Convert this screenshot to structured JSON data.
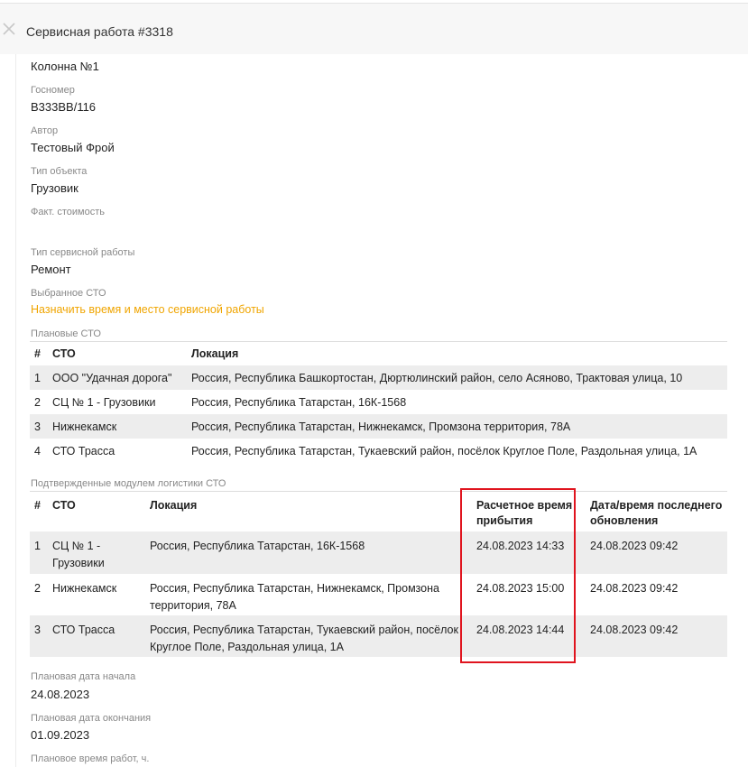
{
  "header": {
    "title": "Сервисная работа #3318"
  },
  "fields": {
    "column_value": "Колонна №1",
    "plate_label": "Госномер",
    "plate_value": "В333ВВ/116",
    "author_label": "Автор",
    "author_value": "Тестовый Фрой",
    "object_type_label": "Тип объекта",
    "object_type_value": "Грузовик",
    "fact_cost_label": "Факт. стоимость",
    "service_type_label": "Тип сервисной работы",
    "service_type_value": "Ремонт",
    "selected_sto_label": "Выбранное СТО",
    "assign_link": "Назначить время и место сервисной работы",
    "planned_sto_label": "Плановые СТО",
    "confirmed_sto_label": "Подтвержденные модулем логистики СТО",
    "plan_start_label": "Плановая дата начала",
    "plan_start_value": "24.08.2023",
    "plan_end_label": "Плановая дата окончания",
    "plan_end_value": "01.09.2023",
    "plan_hours_label": "Плановое время работ, ч."
  },
  "planned_table": {
    "headers": [
      "#",
      "СТО",
      "Локация"
    ],
    "rows": [
      {
        "num": "1",
        "sto": "ООО \"Удачная дорога\"",
        "location": "Россия, Республика Башкортостан, Дюртюлинский район, село Асяново, Трактовая улица, 10"
      },
      {
        "num": "2",
        "sto": "СЦ № 1 - Грузовики",
        "location": "Россия, Республика Татарстан, 16К-1568"
      },
      {
        "num": "3",
        "sto": "Нижнекамск",
        "location": "Россия, Республика Татарстан, Нижнекамск, Промзона территория, 78А"
      },
      {
        "num": "4",
        "sto": "СТО Трасса",
        "location": "Россия, Республика Татарстан, Тукаевский район, посёлок Круглое Поле, Раздольная улица, 1А"
      }
    ]
  },
  "confirmed_table": {
    "headers": [
      "#",
      "СТО",
      "Локация",
      "Расчетное время прибытия",
      "Дата/время последнего обновления"
    ],
    "rows": [
      {
        "num": "1",
        "sto": "СЦ № 1 - Грузовики",
        "location": "Россия, Республика Татарстан, 16К-1568",
        "eta": "24.08.2023 14:33",
        "updated": "24.08.2023 09:42"
      },
      {
        "num": "2",
        "sto": "Нижнекамск",
        "location": "Россия, Республика Татарстан, Нижнекамск, Промзона территория, 78А",
        "eta": "24.08.2023 15:00",
        "updated": "24.08.2023 09:42"
      },
      {
        "num": "3",
        "sto": "СТО Трасса",
        "location": "Россия, Республика Татарстан, Тукаевский район, посёлок Круглое Поле, Раздольная улица, 1А",
        "eta": "24.08.2023 14:44",
        "updated": "24.08.2023 09:42"
      }
    ]
  },
  "icons": {
    "close": "close-icon"
  },
  "colors": {
    "link": "#f0a500",
    "highlight_box": "#e0141e",
    "header_bg": "#f7f7f7",
    "row_shade": "#ededed"
  }
}
